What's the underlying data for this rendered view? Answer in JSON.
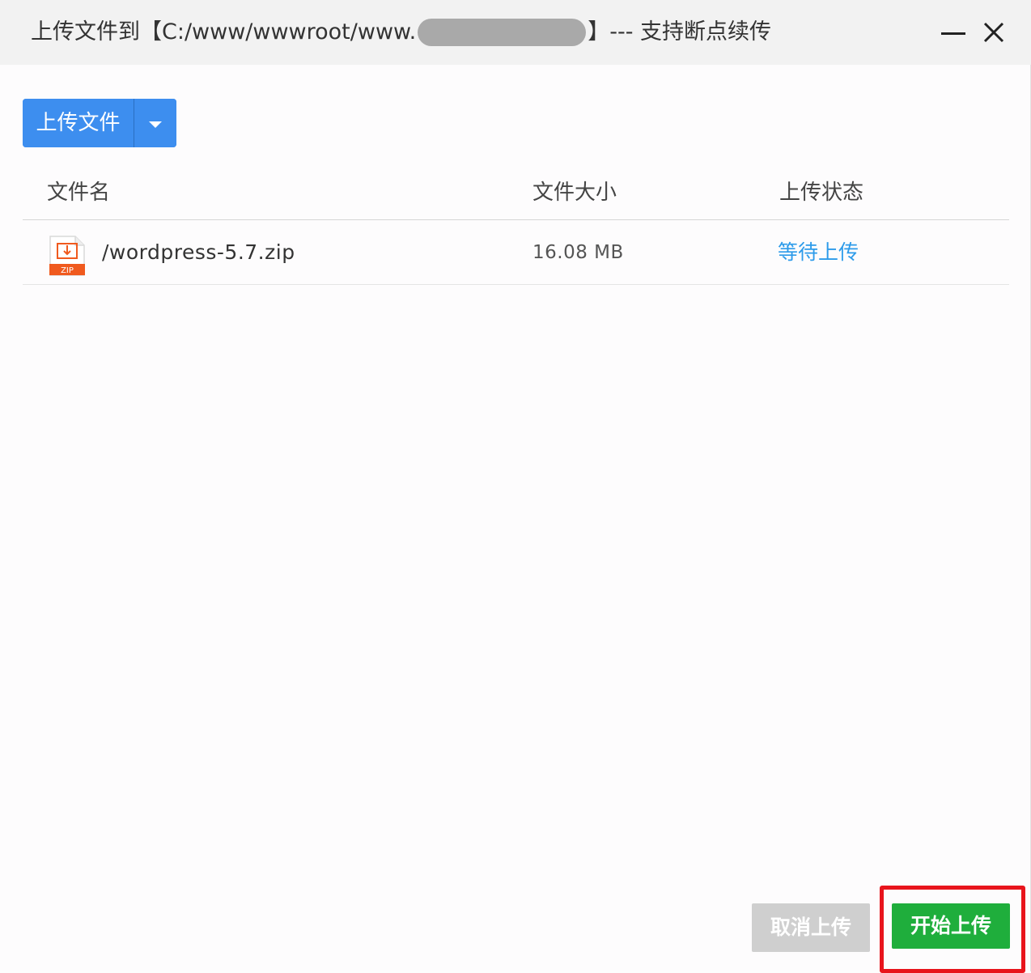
{
  "window": {
    "title_prefix": "上传文件到【C:/www/wwwroot/www.",
    "title_suffix": "】--- 支持断点续传",
    "minimize_label": "",
    "close_label": ""
  },
  "toolbar": {
    "upload_label": "上传文件",
    "dropdown_icon": "caret-down-icon"
  },
  "table": {
    "columns": [
      "文件名",
      "文件大小",
      "上传状态"
    ],
    "rows": [
      {
        "icon": "zip-file-icon",
        "name": "/wordpress-5.7.zip",
        "size": "16.08 MB",
        "status": "等待上传"
      }
    ]
  },
  "footer": {
    "cancel_label": "取消上传",
    "start_label": "开始上传"
  },
  "colors": {
    "primary": "#3d8eef",
    "success": "#1fae3c",
    "disabled": "#cfcfcf",
    "status_link": "#2d9bea",
    "highlight": "#e8141c",
    "zip_orange": "#f05a1e"
  }
}
